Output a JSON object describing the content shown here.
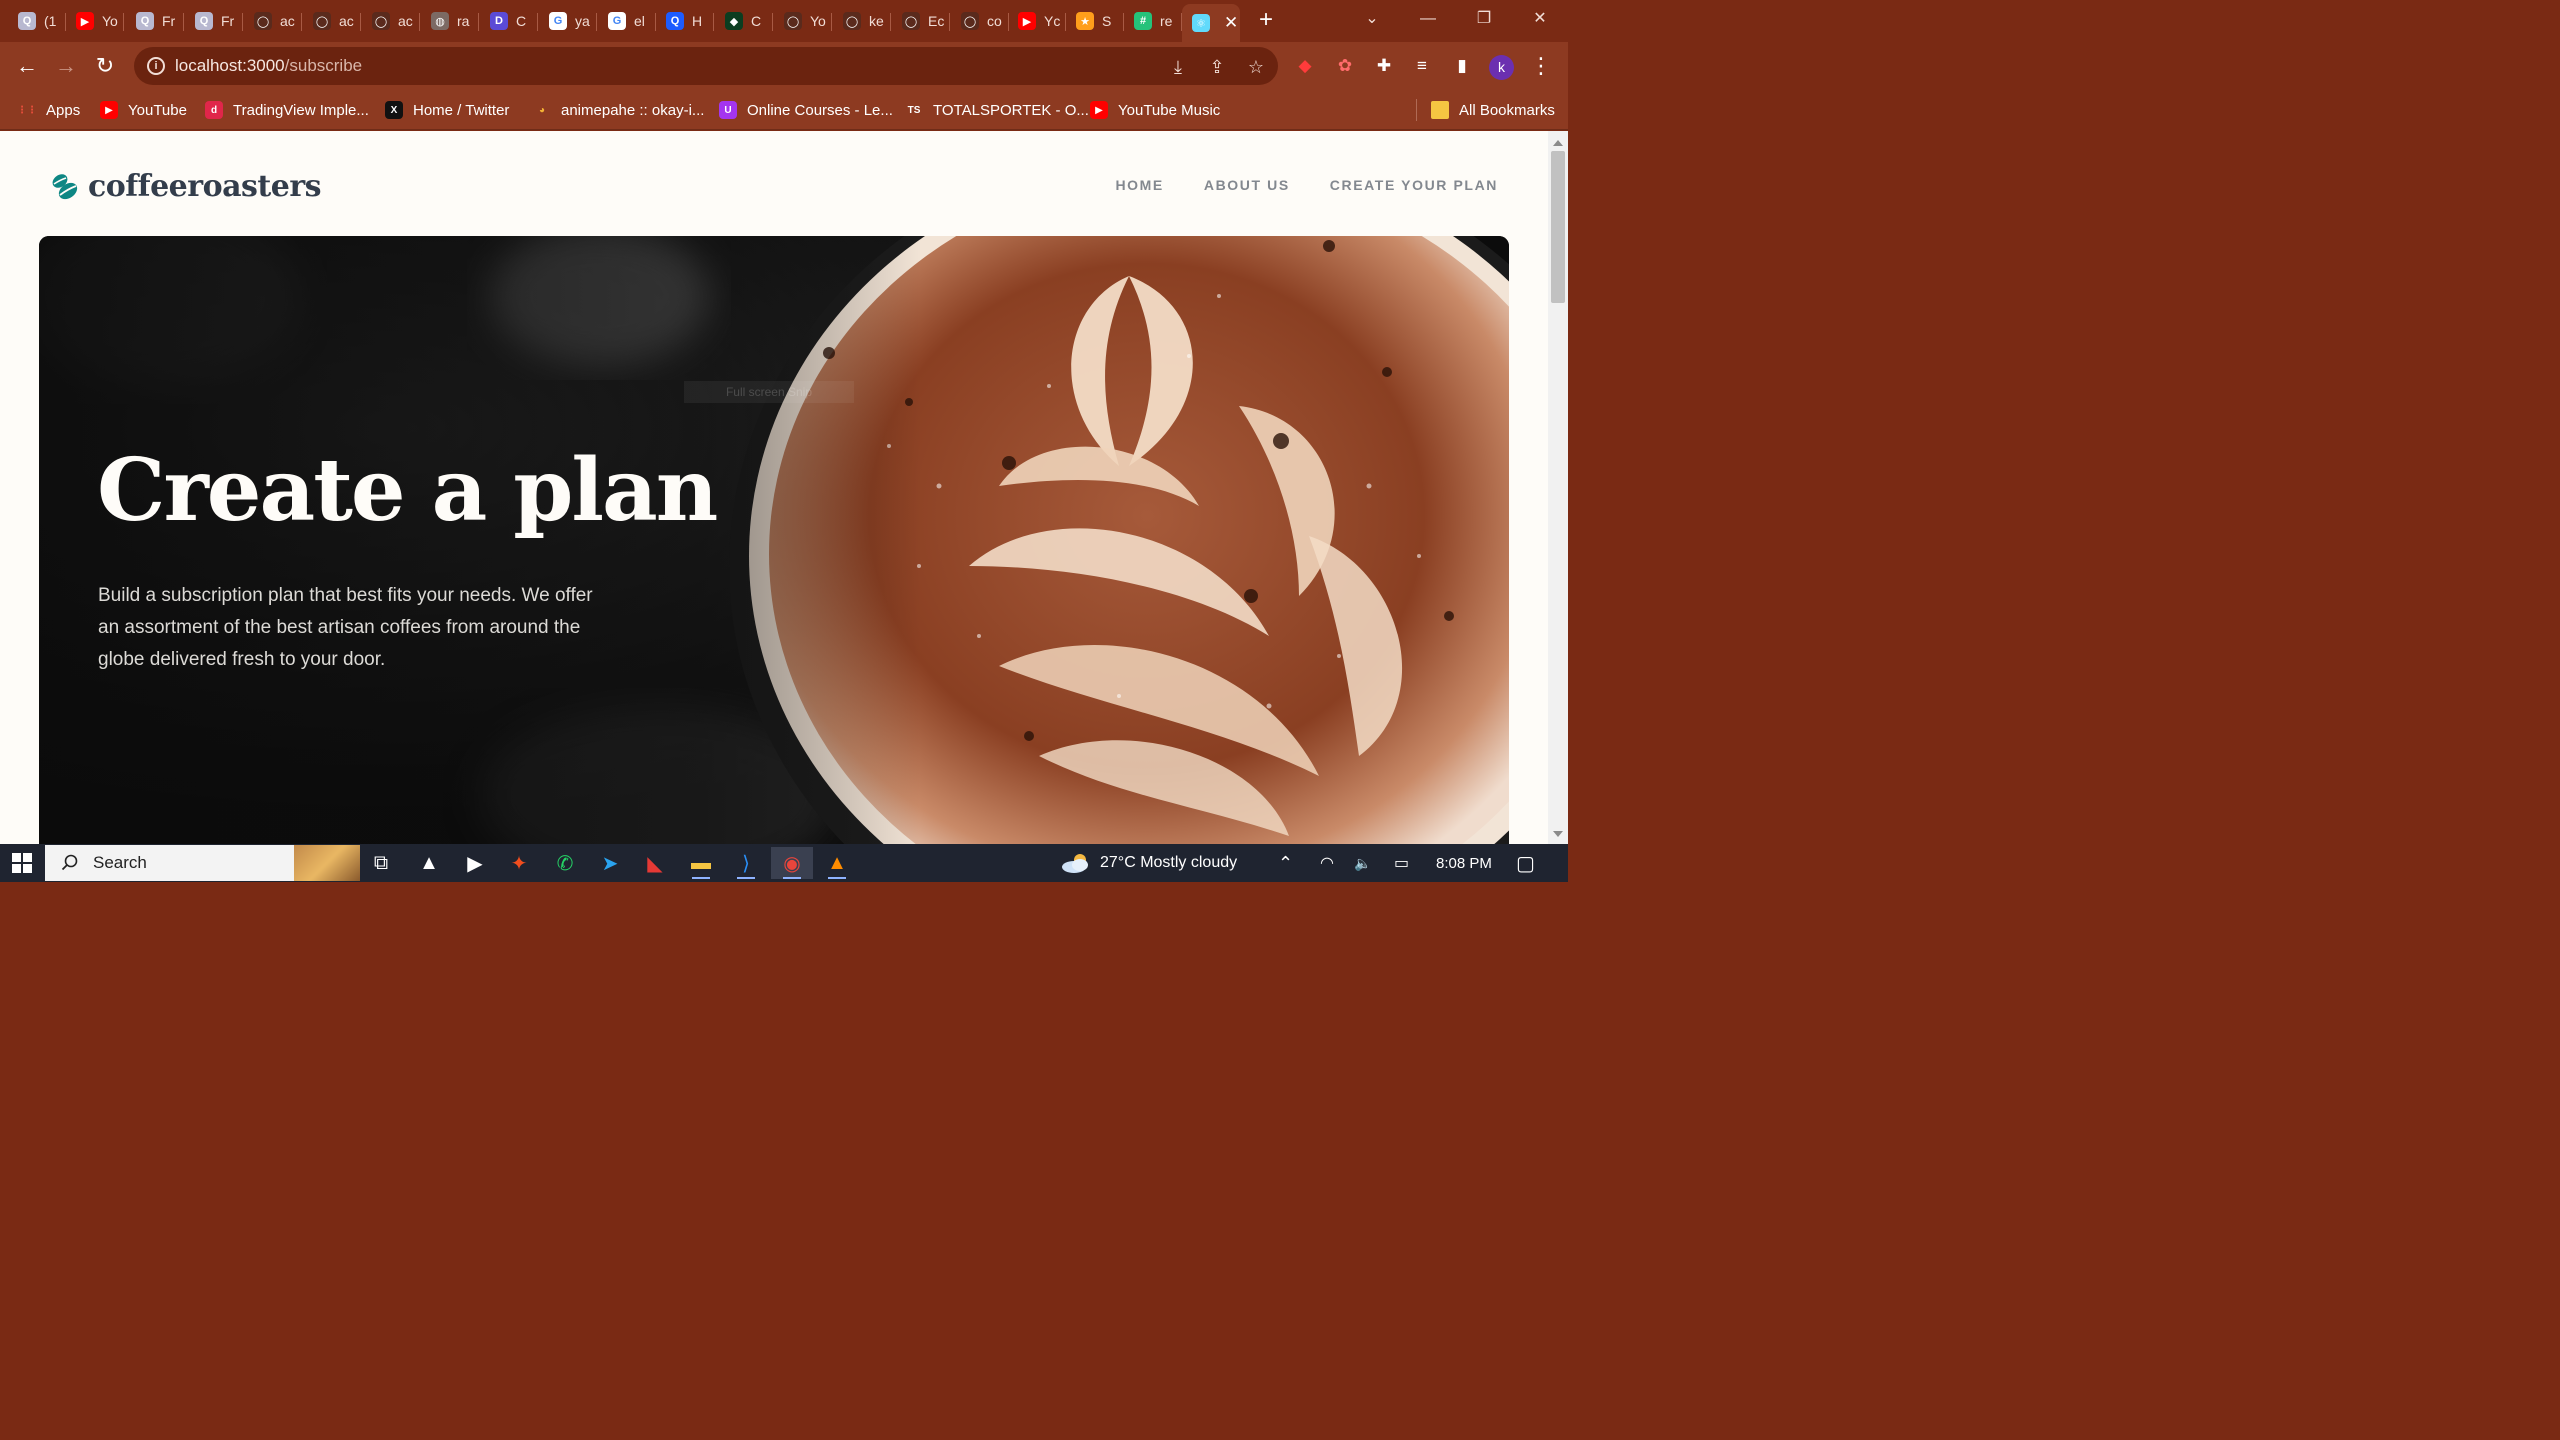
{
  "browser": {
    "tabs": [
      {
        "label": "(1",
        "icon_name": "search-tab-icon",
        "color": "#b8b8d0",
        "glyph": "Q"
      },
      {
        "label": "Yo",
        "icon_name": "youtube-icon",
        "color": "#ff0000",
        "glyph": "▶"
      },
      {
        "label": "Fr",
        "icon_name": "search-tab-icon",
        "color": "#b8b8d0",
        "glyph": "Q"
      },
      {
        "label": "Fr",
        "icon_name": "search-tab-icon",
        "color": "#b8b8d0",
        "glyph": "Q"
      },
      {
        "label": "ac",
        "icon_name": "github-icon",
        "color": "#5a2a1c",
        "glyph": "◯"
      },
      {
        "label": "ac",
        "icon_name": "github-icon",
        "color": "#5a2a1c",
        "glyph": "◯"
      },
      {
        "label": "ac",
        "icon_name": "github-icon",
        "color": "#5a2a1c",
        "glyph": "◯"
      },
      {
        "label": "ra",
        "icon_name": "globe-icon",
        "color": "#7c6a64",
        "glyph": "◍"
      },
      {
        "label": "C",
        "icon_name": "discord-like-icon",
        "color": "#5b4bd6",
        "glyph": "D"
      },
      {
        "label": "ya",
        "icon_name": "google-icon",
        "color": "#ffffff",
        "glyph": "G"
      },
      {
        "label": "el",
        "icon_name": "google-icon",
        "color": "#ffffff",
        "glyph": "G"
      },
      {
        "label": "H",
        "icon_name": "q-app-icon",
        "color": "#1d5cff",
        "glyph": "Q"
      },
      {
        "label": "C",
        "icon_name": "mongodb-icon",
        "color": "#0b3d20",
        "glyph": "◆"
      },
      {
        "label": "Yo",
        "icon_name": "github-icon",
        "color": "#5a2a1c",
        "glyph": "◯"
      },
      {
        "label": "ke",
        "icon_name": "github-icon",
        "color": "#5a2a1c",
        "glyph": "◯"
      },
      {
        "label": "Ec",
        "icon_name": "github-icon",
        "color": "#5a2a1c",
        "glyph": "◯"
      },
      {
        "label": "co",
        "icon_name": "github-icon",
        "color": "#5a2a1c",
        "glyph": "◯"
      },
      {
        "label": "Yc",
        "icon_name": "youtube-music-icon",
        "color": "#ff0000",
        "glyph": "▶"
      },
      {
        "label": "S",
        "icon_name": "star-app-icon",
        "color": "#ff9e1b",
        "glyph": "★"
      },
      {
        "label": "re",
        "icon_name": "grid-app-icon",
        "color": "#25c27a",
        "glyph": "#"
      },
      {
        "label": "",
        "icon_name": "react-icon",
        "color": "#61dafb",
        "glyph": "⚛",
        "active": true
      }
    ],
    "new_tab_glyph": "+",
    "tab_search_glyph": "⌄",
    "window_controls": {
      "minimize": "—",
      "maximize": "❐",
      "close": "✕"
    },
    "nav": {
      "back": "←",
      "forward": "→",
      "reload": "↻"
    },
    "url_host": "localhost:3000",
    "url_path": "/subscribe",
    "info_glyph": "i",
    "omnibox_icons": [
      {
        "name": "install-app-icon",
        "glyph": "⤓"
      },
      {
        "name": "share-icon",
        "glyph": "⇪"
      },
      {
        "name": "bookmark-star-icon",
        "glyph": "☆"
      }
    ],
    "extensions": [
      {
        "name": "extension-red-icon",
        "glyph": "◆",
        "color": "#ff3b3b"
      },
      {
        "name": "extension-flower-icon",
        "glyph": "✿",
        "color": "#ff6b6b"
      },
      {
        "name": "extensions-puzzle-icon",
        "glyph": "✚",
        "color": "#ffffff"
      },
      {
        "name": "reading-list-icon",
        "glyph": "≡",
        "color": "#ffffff"
      },
      {
        "name": "side-panel-icon",
        "glyph": "▮",
        "color": "#ffffff"
      }
    ],
    "profile_initial": "k",
    "menu_glyph": "⋮",
    "bookmarks": [
      {
        "label": "Apps",
        "icon_name": "apps-grid-icon",
        "color": "#e94e3c",
        "glyph": "⋮⋮"
      },
      {
        "label": "YouTube",
        "icon_name": "youtube-icon",
        "color": "#ff0000",
        "glyph": "▶"
      },
      {
        "label": "TradingView Imple...",
        "icon_name": "tradingview-icon",
        "color": "#e0264a",
        "glyph": "d"
      },
      {
        "label": "Home / Twitter",
        "icon_name": "x-twitter-icon",
        "color": "#111111",
        "glyph": "X"
      },
      {
        "label": "animepahe :: okay-i...",
        "icon_name": "animepahe-icon",
        "color": "#f2b134",
        "glyph": "◕"
      },
      {
        "label": "Online Courses - Le...",
        "icon_name": "udemy-icon",
        "color": "#a435f0",
        "glyph": "U"
      },
      {
        "label": "TOTALSPORTEK - O...",
        "icon_name": "totalsportek-icon",
        "color": "#8d3a21",
        "glyph": "TS"
      },
      {
        "label": "YouTube Music",
        "icon_name": "youtube-music-icon",
        "color": "#ff0000",
        "glyph": "▶"
      }
    ],
    "all_bookmarks": {
      "label": "All Bookmarks",
      "icon_name": "folder-icon",
      "color": "#f5c542"
    }
  },
  "site": {
    "logo_text": "coffeeroasters",
    "logo_color": "#0e8784",
    "nav": [
      "HOME",
      "ABOUT US",
      "CREATE YOUR PLAN"
    ],
    "hero": {
      "title": "Create a plan",
      "description": "Build a subscription plan that best fits your needs. We offer an assortment of the best artisan coffees from around the globe delivered fresh to your door.",
      "overlay_hint": "Full screen Snip"
    }
  },
  "taskbar": {
    "search_label": "Search",
    "apps": [
      {
        "name": "task-view-icon",
        "glyph": "⧉",
        "color": "#ffffff"
      },
      {
        "name": "drive-app-icon",
        "glyph": "▲",
        "color": "#ffffff"
      },
      {
        "name": "media-player-icon",
        "glyph": "▶",
        "color": "#ffffff"
      },
      {
        "name": "figma-icon",
        "glyph": "✦",
        "color": "#f24e1e"
      },
      {
        "name": "whatsapp-icon",
        "glyph": "✆",
        "color": "#25d366"
      },
      {
        "name": "telegram-icon",
        "glyph": "➤",
        "color": "#2aa3ef"
      },
      {
        "name": "app-red-icon",
        "glyph": "◣",
        "color": "#e53935"
      },
      {
        "name": "file-explorer-icon",
        "glyph": "▬",
        "color": "#f5c542"
      },
      {
        "name": "vscode-icon",
        "glyph": "⟩",
        "color": "#2a8ff7"
      },
      {
        "name": "chrome-icon",
        "glyph": "◉",
        "color": "#e8453c",
        "active": true
      },
      {
        "name": "vlc-icon",
        "glyph": "▲",
        "color": "#ff8c00"
      }
    ],
    "weather": "27°C  Mostly cloudy",
    "tray_glyphs": {
      "chevron": "⌃",
      "wifi": "◠",
      "volume": "🔈",
      "battery": "▭"
    },
    "time": "8:08 PM",
    "notification_glyph": "▢"
  }
}
